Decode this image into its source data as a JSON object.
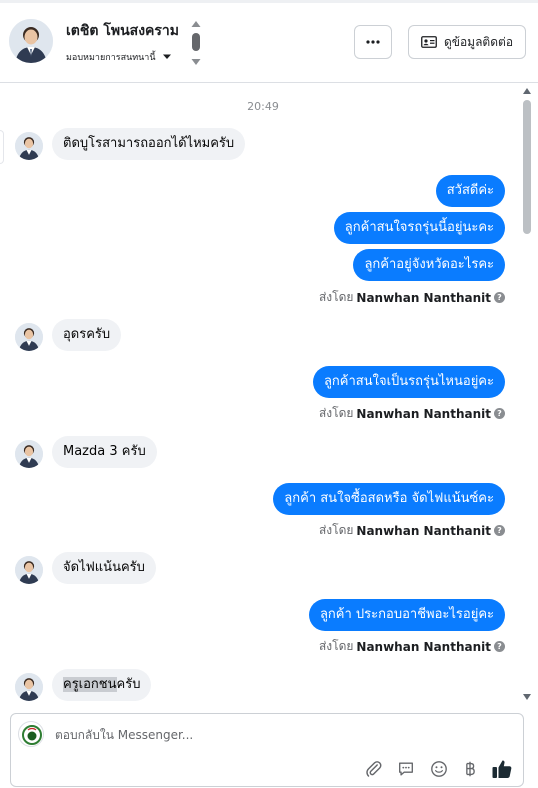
{
  "header": {
    "contact_name": "เตชิต โพนสงคราม",
    "assign_label": "มอบหมายการสนทนานี้",
    "more_label": "···",
    "contact_info_label": "ดูข้อมูลติดต่อ"
  },
  "thread": {
    "timestamp": "20:49",
    "sender_prefix": "ส่งโดย",
    "sender_name": "Nanwhan Nanthanit",
    "help_glyph": "?",
    "messages": [
      {
        "dir": "in",
        "text": "ติดบูโรสามารถออกได้ไหมครับ"
      },
      {
        "dir": "out",
        "text": "สวัสดีค่ะ"
      },
      {
        "dir": "out",
        "text": "ลูกค้าสนใจรถรุ่นนี้อยู่นะคะ"
      },
      {
        "dir": "out",
        "text": "ลูกค้าอยู่จังหวัดอะไรคะ"
      },
      {
        "dir": "in",
        "text": "อุดรครับ"
      },
      {
        "dir": "out",
        "text": "ลูกค้าสนใจเป็นรถรุ่นไหนอยู่คะ"
      },
      {
        "dir": "in",
        "text": "Mazda 3 ครับ"
      },
      {
        "dir": "out",
        "text": "ลูกค้า สนใจซื้อสดหรือ จัดไฟแน้นซ์คะ"
      },
      {
        "dir": "in",
        "text": "จัดไฟแน้นครับ"
      },
      {
        "dir": "out",
        "text": "ลูกค้า ประกอบอาชีพอะไรอยู่คะ"
      },
      {
        "dir": "in",
        "text_highlight": "ครูเอกชน",
        "text_rest": "ครับ"
      }
    ]
  },
  "composer": {
    "placeholder": "ตอบกลับใน Messenger..."
  },
  "colors": {
    "outgoing_bubble": "#0a7cff",
    "incoming_bubble": "#f0f2f5",
    "like_icon": "#1c2b33"
  },
  "icons": [
    "avatar-photo",
    "chevron-down-icon",
    "more-icon",
    "contact-card-icon",
    "attach-icon",
    "saved-reply-icon",
    "emoji-icon",
    "baht-icon",
    "like-icon",
    "help-icon"
  ]
}
